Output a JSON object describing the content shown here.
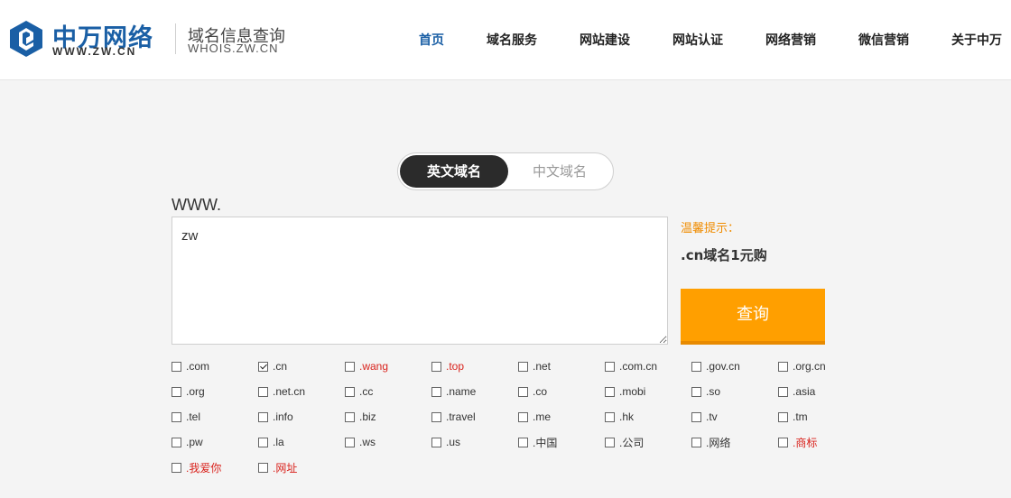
{
  "logo": {
    "brand_cn": "中万网络",
    "brand_url": "WWW.ZW.CN",
    "site_title": "域名信息查询",
    "site_sub": "WHOIS.ZW.CN",
    "colors": {
      "brand": "#1a5fa5"
    }
  },
  "nav": {
    "items": [
      {
        "label": "首页",
        "active": true
      },
      {
        "label": "域名服务",
        "active": false
      },
      {
        "label": "网站建设",
        "active": false
      },
      {
        "label": "网站认证",
        "active": false
      },
      {
        "label": "网络营销",
        "active": false
      },
      {
        "label": "微信营销",
        "active": false
      },
      {
        "label": "关于中万",
        "active": false
      }
    ]
  },
  "search": {
    "tab_en": "英文域名",
    "tab_cn": "中文域名",
    "prefix": "WWW.",
    "input_value": "zw",
    "tip_title": "温馨提示：",
    "tip_text": ".cn域名1元购",
    "query_label": "查询",
    "colors": {
      "accent": "#ff9f00",
      "hot": "#d9221c"
    }
  },
  "tlds": [
    {
      "label": ".com",
      "checked": false,
      "hot": false
    },
    {
      "label": ".cn",
      "checked": true,
      "hot": false
    },
    {
      "label": ".wang",
      "checked": false,
      "hot": true
    },
    {
      "label": ".top",
      "checked": false,
      "hot": true
    },
    {
      "label": ".net",
      "checked": false,
      "hot": false
    },
    {
      "label": ".com.cn",
      "checked": false,
      "hot": false
    },
    {
      "label": ".gov.cn",
      "checked": false,
      "hot": false
    },
    {
      "label": ".org.cn",
      "checked": false,
      "hot": false
    },
    {
      "label": ".org",
      "checked": false,
      "hot": false
    },
    {
      "label": ".net.cn",
      "checked": false,
      "hot": false
    },
    {
      "label": ".cc",
      "checked": false,
      "hot": false
    },
    {
      "label": ".name",
      "checked": false,
      "hot": false
    },
    {
      "label": ".co",
      "checked": false,
      "hot": false
    },
    {
      "label": ".mobi",
      "checked": false,
      "hot": false
    },
    {
      "label": ".so",
      "checked": false,
      "hot": false
    },
    {
      "label": ".asia",
      "checked": false,
      "hot": false
    },
    {
      "label": ".tel",
      "checked": false,
      "hot": false
    },
    {
      "label": ".info",
      "checked": false,
      "hot": false
    },
    {
      "label": ".biz",
      "checked": false,
      "hot": false
    },
    {
      "label": ".travel",
      "checked": false,
      "hot": false
    },
    {
      "label": ".me",
      "checked": false,
      "hot": false
    },
    {
      "label": ".hk",
      "checked": false,
      "hot": false
    },
    {
      "label": ".tv",
      "checked": false,
      "hot": false
    },
    {
      "label": ".tm",
      "checked": false,
      "hot": false
    },
    {
      "label": ".pw",
      "checked": false,
      "hot": false
    },
    {
      "label": ".la",
      "checked": false,
      "hot": false
    },
    {
      "label": ".ws",
      "checked": false,
      "hot": false
    },
    {
      "label": ".us",
      "checked": false,
      "hot": false
    },
    {
      "label": ".中国",
      "checked": false,
      "hot": false
    },
    {
      "label": ".公司",
      "checked": false,
      "hot": false
    },
    {
      "label": ".网络",
      "checked": false,
      "hot": false
    },
    {
      "label": ".商标",
      "checked": false,
      "hot": true
    },
    {
      "label": ".我爱你",
      "checked": false,
      "hot": true
    },
    {
      "label": ".网址",
      "checked": false,
      "hot": true
    }
  ]
}
